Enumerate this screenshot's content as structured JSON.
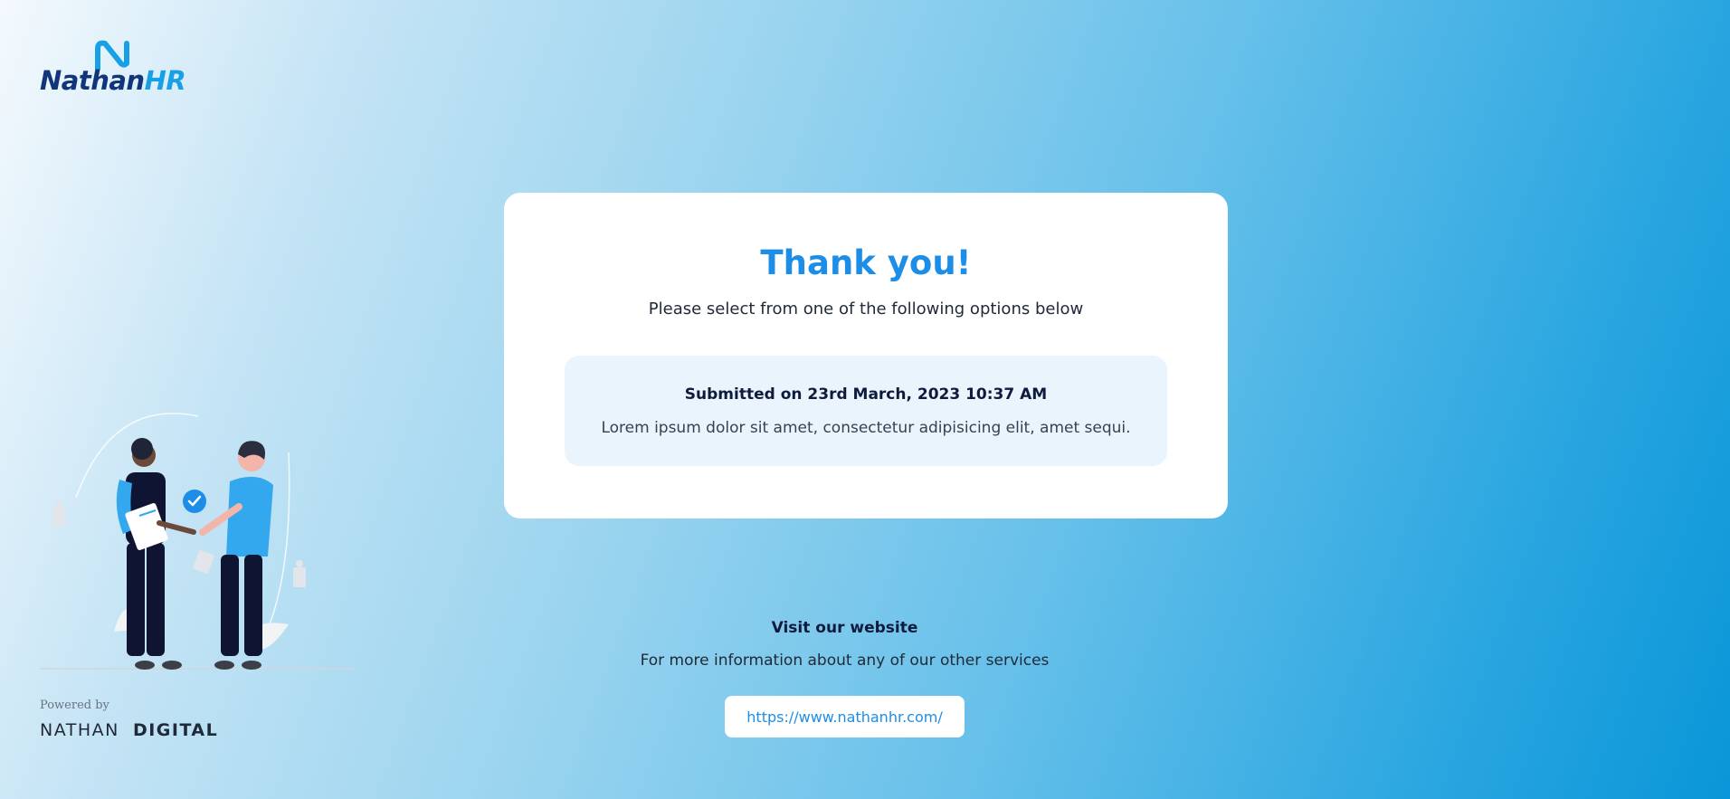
{
  "brand": {
    "name_main": "Nathan",
    "name_accent": "HR",
    "accent_color": "#1d8ee8",
    "powered_by": "Powered by",
    "partner_main": "NATHAN",
    "partner_accent": "DIGITAL"
  },
  "card": {
    "title": "Thank you!",
    "subtitle": "Please select from one of the following options below",
    "submission": {
      "date": "Submitted on 23rd March, 2023 10:37 AM",
      "text": "Lorem ipsum dolor sit amet, consectetur adipisicing elit, amet sequi."
    }
  },
  "visit": {
    "title": "Visit our website",
    "subtitle": "For more information about any of our other services",
    "link_label": "https://www.nathanhr.com/"
  },
  "illustration": {
    "icon": "handshake-illustration"
  }
}
